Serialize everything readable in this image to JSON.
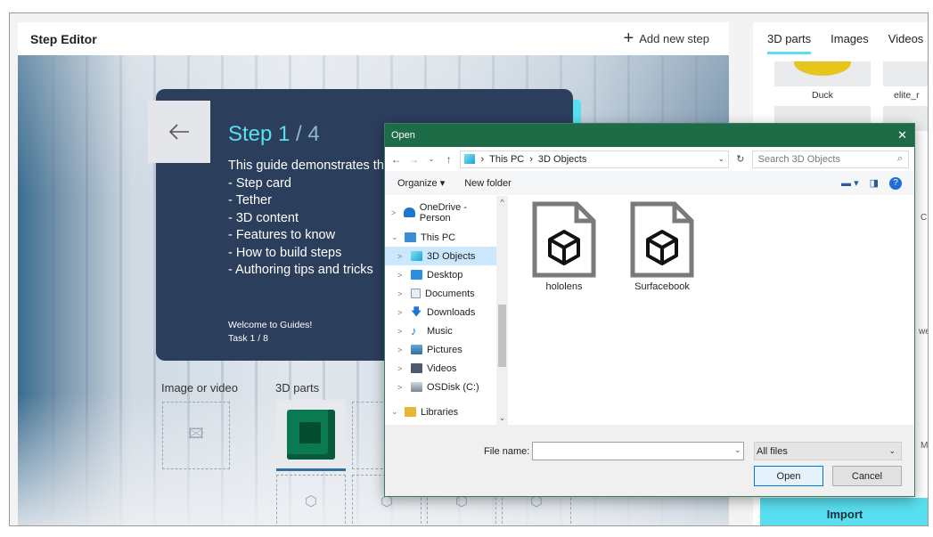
{
  "editor": {
    "title": "Step Editor",
    "add_step_label": "Add new step"
  },
  "step_card": {
    "current": "Step 1",
    "total": " / 4",
    "lines": [
      "This guide demonstrates th",
      "- Step card",
      "- Tether",
      "- 3D content",
      "- Features to know",
      "- How to build steps",
      "- Authoring tips and tricks"
    ],
    "footer_line1": "Welcome to Guides!",
    "footer_line2": "Task 1 / 8"
  },
  "sections": {
    "media_label": "Image or video",
    "parts_label": "3D parts"
  },
  "right_panel": {
    "tabs": [
      "3D parts",
      "Images",
      "Videos"
    ],
    "active_tab": "3D parts",
    "thumb_labels": [
      "Duck",
      "elite_r"
    ],
    "peek_letters": [
      "C",
      "we",
      "M"
    ],
    "import_label": "Import"
  },
  "dialog": {
    "title": "Open",
    "close": "✕",
    "address": [
      "This PC",
      "3D Objects"
    ],
    "search_placeholder": "Search 3D Objects",
    "organize": "Organize ▾",
    "new_folder": "New folder",
    "nav_items": [
      {
        "label": "OneDrive - Person",
        "expander": ">"
      },
      {
        "label": "This PC",
        "expander": "⌄"
      },
      {
        "label": "3D Objects",
        "expander": ">"
      },
      {
        "label": "Desktop",
        "expander": ">"
      },
      {
        "label": "Documents",
        "expander": ">"
      },
      {
        "label": "Downloads",
        "expander": ">"
      },
      {
        "label": "Music",
        "expander": ">"
      },
      {
        "label": "Pictures",
        "expander": ">"
      },
      {
        "label": "Videos",
        "expander": ">"
      },
      {
        "label": "OSDisk (C:)",
        "expander": ">"
      },
      {
        "label": "Libraries",
        "expander": "⌄"
      }
    ],
    "files": [
      "hololens",
      "Surfacebook"
    ],
    "file_name_label": "File name:",
    "file_name_value": "",
    "filter_value": "All files",
    "open_label": "Open",
    "cancel_label": "Cancel"
  },
  "colors": {
    "accent_teal": "#58dff0",
    "card_navy": "#2b3e5c",
    "dialog_green": "#1e6b47",
    "selection_blue": "#cce8ff"
  }
}
